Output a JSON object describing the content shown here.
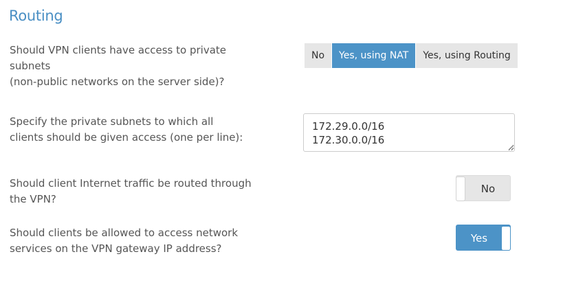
{
  "section": {
    "title": "Routing"
  },
  "questions": {
    "access_private": {
      "line1": "Should VPN clients have access to private",
      "line2": "subnets",
      "line3": "(non-public networks on the server side)?"
    },
    "subnets": {
      "line1": "Specify the private subnets to which all",
      "line2": "clients should be given access (one per line):"
    },
    "internet_traffic": {
      "line1": "Should client Internet traffic be routed through",
      "line2": "the VPN?"
    },
    "gateway_services": {
      "line1": "Should clients be allowed to access network",
      "line2": "services on the VPN gateway IP address?"
    }
  },
  "access_mode": {
    "options": [
      "No",
      "Yes, using NAT",
      "Yes, using Routing"
    ],
    "selected": "Yes, using NAT",
    "colors": {
      "active": "#4c93c7",
      "inactive": "#e6e6e6"
    }
  },
  "subnets_field": {
    "value": "172.29.0.0/16\n172.30.0.0/16"
  },
  "toggles": {
    "internet_traffic": {
      "label": "No",
      "state": "off"
    },
    "gateway_services": {
      "label": "Yes",
      "state": "on"
    }
  },
  "colors": {
    "title": "#4a8fc4",
    "accent": "#4c93c7",
    "text": "#555555"
  }
}
